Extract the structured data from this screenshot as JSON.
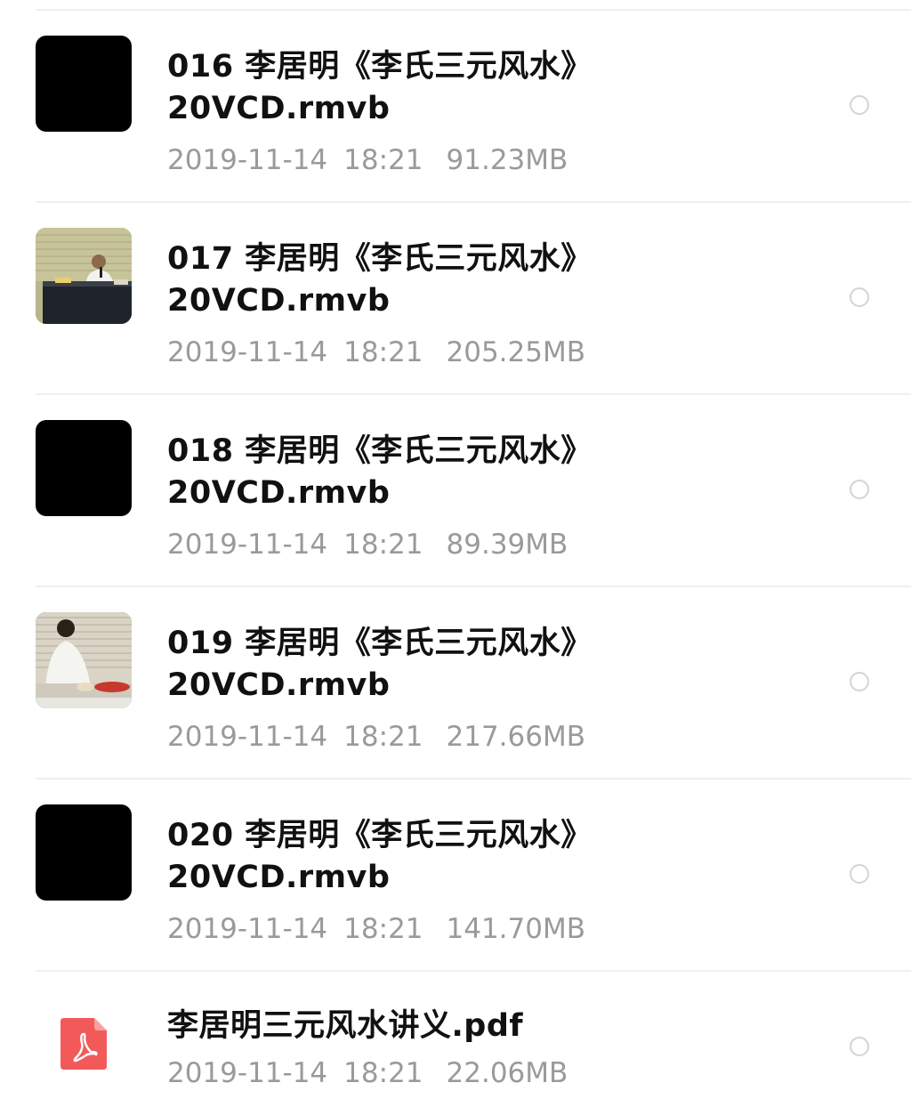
{
  "files": [
    {
      "name_line1": "016 李居明《李氏三元风水》",
      "name_line2": "20VCD.rmvb",
      "date": "2019-11-14",
      "time": "18:21",
      "size": "91.23MB",
      "thumbnail": "black"
    },
    {
      "name_line1": "017 李居明《李氏三元风水》",
      "name_line2": "20VCD.rmvb",
      "date": "2019-11-14",
      "time": "18:21",
      "size": "205.25MB",
      "thumbnail": "video-frame-lecture"
    },
    {
      "name_line1": "018 李居明《李氏三元风水》",
      "name_line2": "20VCD.rmvb",
      "date": "2019-11-14",
      "time": "18:21",
      "size": "89.39MB",
      "thumbnail": "black"
    },
    {
      "name_line1": "019 李居明《李氏三元风水》",
      "name_line2": "20VCD.rmvb",
      "date": "2019-11-14",
      "time": "18:21",
      "size": "217.66MB",
      "thumbnail": "video-frame-speaker"
    },
    {
      "name_line1": "020 李居明《李氏三元风水》",
      "name_line2": "20VCD.rmvb",
      "date": "2019-11-14",
      "time": "18:21",
      "size": "141.70MB",
      "thumbnail": "black"
    }
  ],
  "pdf": {
    "name": "李居明三元风水讲义.pdf",
    "date": "2019-11-14",
    "time": "18:21",
    "size": "22.06MB",
    "icon": "pdf-icon",
    "icon_color": "#f25a5a"
  },
  "colors": {
    "title": "#111111",
    "meta": "#9a9a9a",
    "divider": "#efefef",
    "checkbox": "#d4d4d4"
  }
}
